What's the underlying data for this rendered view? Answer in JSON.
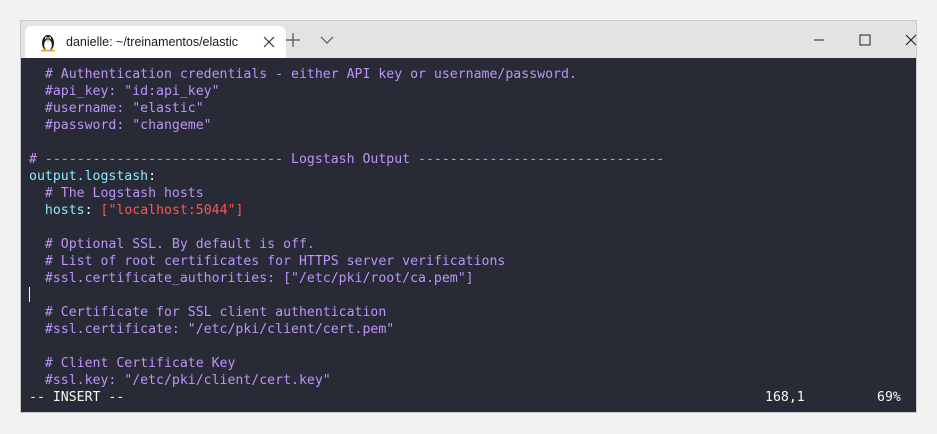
{
  "window": {
    "tab_title": "danielle: ~/treinamentos/elastic",
    "icons": {
      "tab_icon": "linux-tux-icon",
      "tab_close": "close-icon",
      "new_tab": "plus-icon",
      "tab_dropdown": "chevron-down-icon",
      "minimize": "minimize-icon",
      "maximize": "maximize-icon",
      "close": "close-icon"
    }
  },
  "colors": {
    "background": "#282a36",
    "comment": "#bd93f9",
    "key": "#8be9fd",
    "string": "#ff5555",
    "foreground": "#f8f8f2"
  },
  "editor": {
    "lines": {
      "l1": "  # Authentication credentials - either API key or username/password.",
      "l2": "  #api_key: \"id:api_key\"",
      "l3": "  #username: \"elastic\"",
      "l4": "  #password: \"changeme\"",
      "l6": "# ------------------------------ Logstash Output -------------------------------",
      "l7_key": "output.logstash",
      "l7_colon": ":",
      "l8": "  # The Logstash hosts",
      "l9_indent": "  ",
      "l9_key": "hosts",
      "l9_colon": ": ",
      "l9_bracket_open": "[",
      "l9_value": "\"localhost:5044\"",
      "l9_bracket_close": "]",
      "l11": "  # Optional SSL. By default is off.",
      "l12": "  # List of root certificates for HTTPS server verifications",
      "l13": "  #ssl.certificate_authorities: [\"/etc/pki/root/ca.pem\"]",
      "l15": "  # Certificate for SSL client authentication",
      "l16": "  #ssl.certificate: \"/etc/pki/client/cert.pem\"",
      "l18": "  # Client Certificate Key",
      "l19": "  #ssl.key: \"/etc/pki/client/cert.key\""
    },
    "status": {
      "mode": "-- INSERT --",
      "position": "168,1",
      "percent": "69%"
    }
  }
}
